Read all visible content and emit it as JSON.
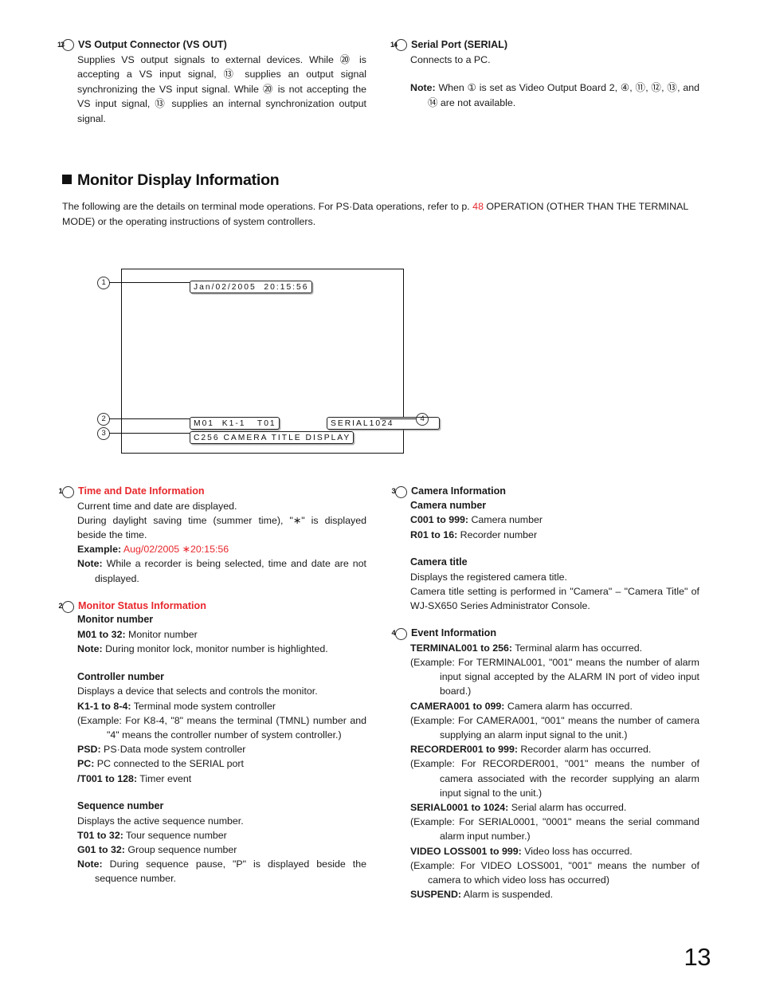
{
  "page_number": "13",
  "top_sections": [
    {
      "marker": "13",
      "title": "VS Output Connector (VS OUT)",
      "body": "Supplies VS output signals to external devices. While ⑳ is accepting a VS input signal, ⑬ supplies an output signal synchronizing the VS input signal. While ⑳ is not accepting the VS input signal, ⑬ supplies an internal synchronization output signal."
    },
    {
      "marker": "14",
      "title": "Serial Port (SERIAL)",
      "body": "Connects to a PC.",
      "note_label": "Note:",
      "note_text": " When ① is set as Video Output Board 2, ④, ⑪, ⑫, ⑬, and ⑭ are not available."
    }
  ],
  "heading": {
    "title": "Monitor Display Information",
    "intro_part1": "The following are the details on terminal mode operations. For PS·Data operations, refer to p. ",
    "intro_page_ref": "48",
    "intro_part2": " OPERATION (OTHER THAN THE TERMINAL MODE) or the operating instructions of system controllers."
  },
  "diagram": {
    "osd_time": "Jan/02/2005  20:15:56",
    "osd_status": "M01  K1-1   T01",
    "osd_title": "C256 CAMERA TITLE DISPLAY",
    "osd_event": "SERIAL1024",
    "callout_1": "1",
    "callout_2": "2",
    "callout_3": "3",
    "callout_4": "4"
  },
  "left_column": {
    "s1": {
      "marker": "1",
      "title": "Time and Date Information",
      "line1": "Current time and date are displayed.",
      "line2": "During daylight saving time (summer time), \"∗\" is displayed beside the time.",
      "example_label": "Example:",
      "example_value": " Aug/02/2005 ∗20:15:56",
      "note_label": "Note:",
      "note_text": " While a recorder is being selected, time and date are not displayed."
    },
    "s2": {
      "marker": "2",
      "title": "Monitor Status Information",
      "sub1": "Monitor number",
      "sub1_line1_b": "M01 to 32:",
      "sub1_line1_t": " Monitor number",
      "sub1_note_label": "Note:",
      "sub1_note_text": " During monitor lock, monitor number is highlighted.",
      "sub2": "Controller number",
      "sub2_line1": "Displays a device that selects and controls the monitor.",
      "sub2_line2_b": "K1-1 to 8-4:",
      "sub2_line2_t": " Terminal mode system controller",
      "sub2_line3": "(Example: For K8-4, \"8\" means the terminal (TMNL) number and \"4\" means the controller number of system controller.)",
      "sub2_line4_b": "PSD:",
      "sub2_line4_t": " PS·Data mode system controller",
      "sub2_line5_b": "PC:",
      "sub2_line5_t": " PC connected to the SERIAL port",
      "sub2_line6_b": "/T001 to 128:",
      "sub2_line6_t": " Timer event",
      "sub3": "Sequence number",
      "sub3_line1": "Displays the active sequence number.",
      "sub3_line2_b": "T01 to 32:",
      "sub3_line2_t": " Tour sequence number",
      "sub3_line3_b": "G01 to 32:",
      "sub3_line3_t": " Group sequence number",
      "sub3_note_label": "Note:",
      "sub3_note_text": " During sequence pause, \"P\" is displayed beside the sequence number."
    }
  },
  "right_column": {
    "s3": {
      "marker": "3",
      "title": "Camera Information",
      "sub1": "Camera number",
      "sub1_line1_b": "C001 to 999:",
      "sub1_line1_t": " Camera number",
      "sub1_line2_b": "R01 to 16:",
      "sub1_line2_t": " Recorder number",
      "sub2": "Camera title",
      "sub2_line1": "Displays the registered camera title.",
      "sub2_line2": "Camera title setting is performed in \"Camera\" – \"Camera Title\" of WJ-SX650 Series  Administrator Console."
    },
    "s4": {
      "marker": "4",
      "title": "Event Information",
      "e1_b": "TERMINAL001 to 256:",
      "e1_t": " Terminal alarm has occurred.",
      "e1_ex": "(Example: For TERMINAL001, \"001\" means the number of alarm input signal accepted by the ALARM IN port of video input board.)",
      "e2_b": "CAMERA001 to 099:",
      "e2_t": " Camera alarm has occurred.",
      "e2_ex": "(Example: For CAMERA001, \"001\" means the number of camera supplying an alarm input signal to the unit.)",
      "e3_b": "RECORDER001 to 999:",
      "e3_t": " Recorder alarm has occurred.",
      "e3_ex": "(Example: For RECORDER001, \"001\" means the number of camera associated with the recorder supplying an alarm input signal to the unit.)",
      "e4_b": "SERIAL0001 to 1024:",
      "e4_t": " Serial alarm has occurred.",
      "e4_ex": "(Example: For SERIAL0001, \"0001\" means the serial command alarm input number.)",
      "e5_b": "VIDEO LOSS001 to 999:",
      "e5_t": " Video loss has occurred.",
      "e5_ex": "(Example: For VIDEO LOSS001, \"001\" means the number of camera to which video loss has occurred)",
      "e6_b": "SUSPEND:",
      "e6_t": " Alarm is suspended."
    }
  }
}
